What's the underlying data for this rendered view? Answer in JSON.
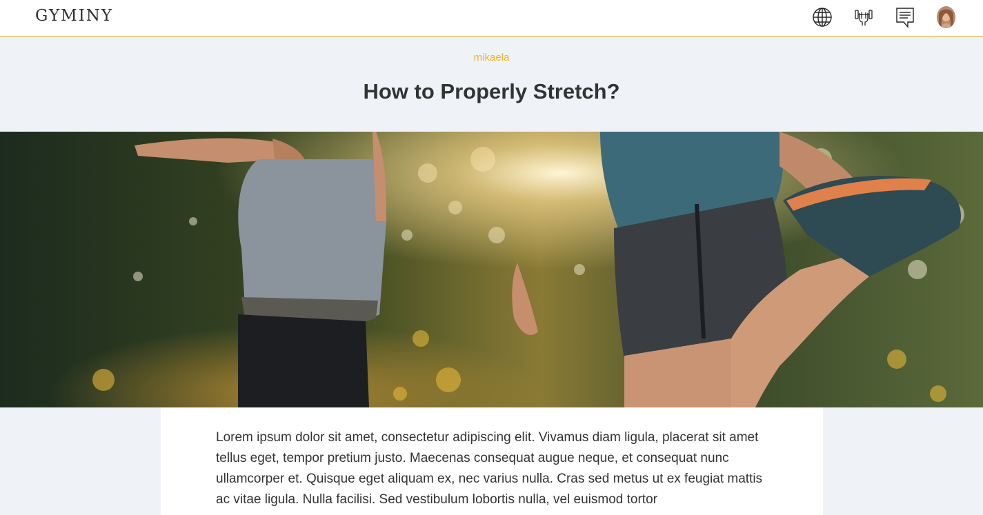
{
  "app": {
    "logo_text": "GYMINY"
  },
  "nav": {
    "icons": [
      "globe-icon",
      "dumbbell-hands-icon",
      "chat-icon",
      "user-avatar"
    ]
  },
  "post": {
    "author": "mikaela",
    "title": "How to Properly Stretch?",
    "body": "Lorem ipsum dolor sit amet, consectetur adipiscing elit. Vivamus diam ligula, placerat sit amet tellus eget, tempor pretium justo. Maecenas consequat augue neque, et consequat nunc ullamcorper et. Quisque eget aliquam ex, nec varius nulla. Cras sed metus ut ex feugiat mattis ac vitae ligula. Nulla facilisi. Sed vestibulum lobortis nulla, vel euismod tortor"
  },
  "colors": {
    "accent": "#f2b229",
    "page_background": "#eff3f8",
    "text": "#333333"
  }
}
